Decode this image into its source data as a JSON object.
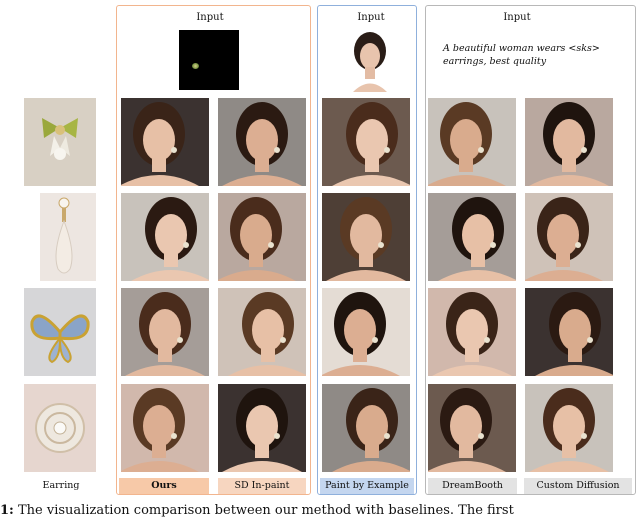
{
  "headers": {
    "ours_input": "Input",
    "pbe_input": "Input",
    "baseline_input": "Input"
  },
  "prompt": "A beautiful woman wears <sks> earrings, best quality",
  "row_label": "Earring",
  "method_labels": {
    "ours": "Ours",
    "sd_inpaint": "SD In-paint",
    "paint_by_example": "Paint by Example",
    "dreambooth": "DreamBooth",
    "custom_diffusion": "Custom Diffusion"
  },
  "caption": {
    "prefix": "1:",
    "text": "The visualization comparison between our method with baselines. The first"
  },
  "colors": {
    "ours_border": "#f2b58e",
    "pbe_border": "#8fb0dc",
    "baseline_border": "#b8b8b8"
  }
}
